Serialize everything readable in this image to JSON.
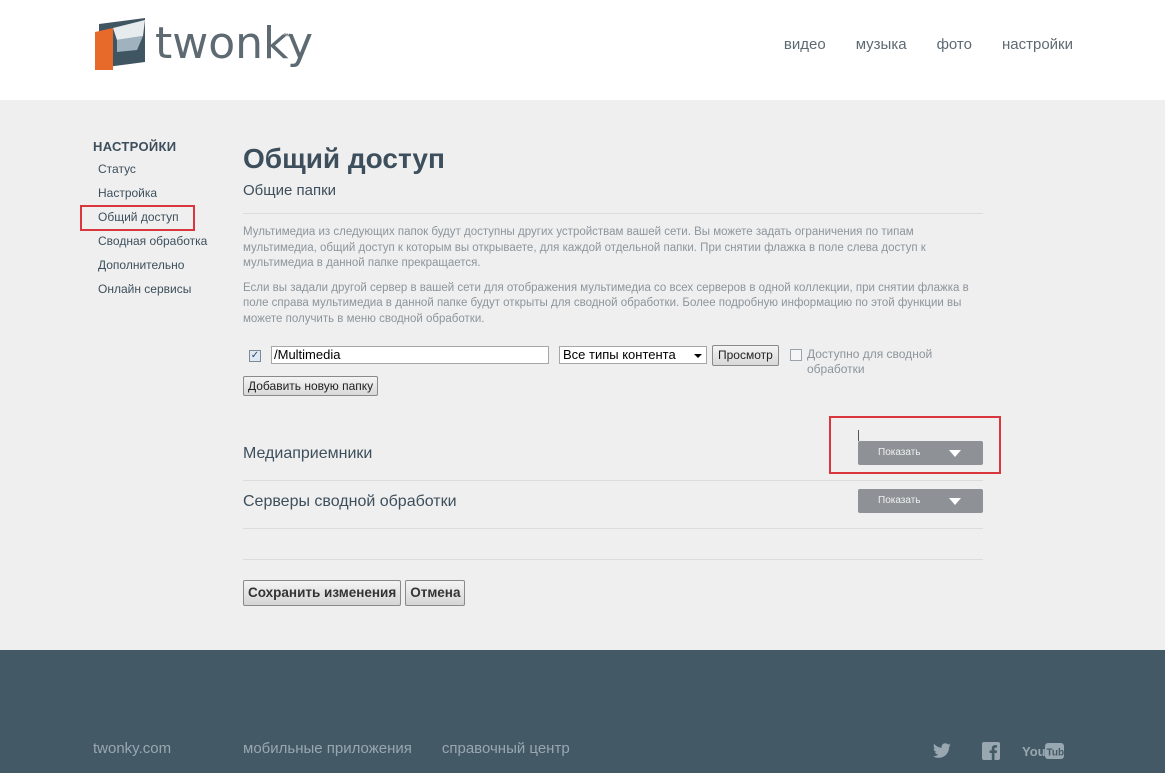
{
  "header": {
    "logo_text": "twonky",
    "logo_tm": "™",
    "nav": [
      "видео",
      "музыка",
      "фото",
      "настройки"
    ]
  },
  "sidebar": {
    "title": "НАСТРОЙКИ",
    "items": [
      {
        "label": "Статус"
      },
      {
        "label": "Настройка"
      },
      {
        "label": "Общий доступ",
        "active": true
      },
      {
        "label": "Сводная обработка"
      },
      {
        "label": "Дополнительно"
      },
      {
        "label": "Онлайн сервисы"
      }
    ]
  },
  "main": {
    "title": "Общий доступ",
    "subtitle": "Общие папки",
    "desc1": "Мультимедиа из следующих папок будут доступны других устройствам вашей сети. Вы можете задать ограничения по типам мультимедиа, общий доступ к которым вы открываете, для каждой отдельной папки. При снятии флажка в поле слева доступ к мультимедиа в данной папке прекращается.",
    "desc2": "Если вы задали другой сервер в вашей сети для отображения мультимедиа со всех серверов в одной коллекции, при снятии флажка в поле справа мультимедиа в данной папке будут открыты для сводной обработки. Более подробную информацию по этой функции вы можете получить в меню сводной обработки.",
    "folder": {
      "checked": true,
      "check_mark": "✓",
      "path": "/Multimedia",
      "content_type": "Все типы контента",
      "browse_label": "Просмотр",
      "aggregate_checked": false,
      "aggregate_label": "Доступно для сводной обработки"
    },
    "add_folder_label": "Добавить новую папку",
    "sections": {
      "receivers_label": "Медиаприемники",
      "receivers_button": "Показать",
      "servers_label": "Серверы сводной обработки",
      "servers_button": "Показать"
    },
    "save_label": "Сохранить изменения",
    "cancel_label": "Отмена"
  },
  "footer": {
    "site": "twonky.com",
    "mobile": "мобильные приложения",
    "help": "справочный центр",
    "social": [
      "twitter-icon",
      "facebook-icon",
      "youtube-icon"
    ],
    "youtube_text": "YouTube"
  },
  "colors": {
    "header_bg": "#ffffff",
    "page_bg": "#efefef",
    "footer_bg": "#435966",
    "highlight": "#d9363e",
    "dropdown_button": "#8e9297",
    "logo_orange": "#e86a2b",
    "logo_dark": "#3f5562"
  }
}
